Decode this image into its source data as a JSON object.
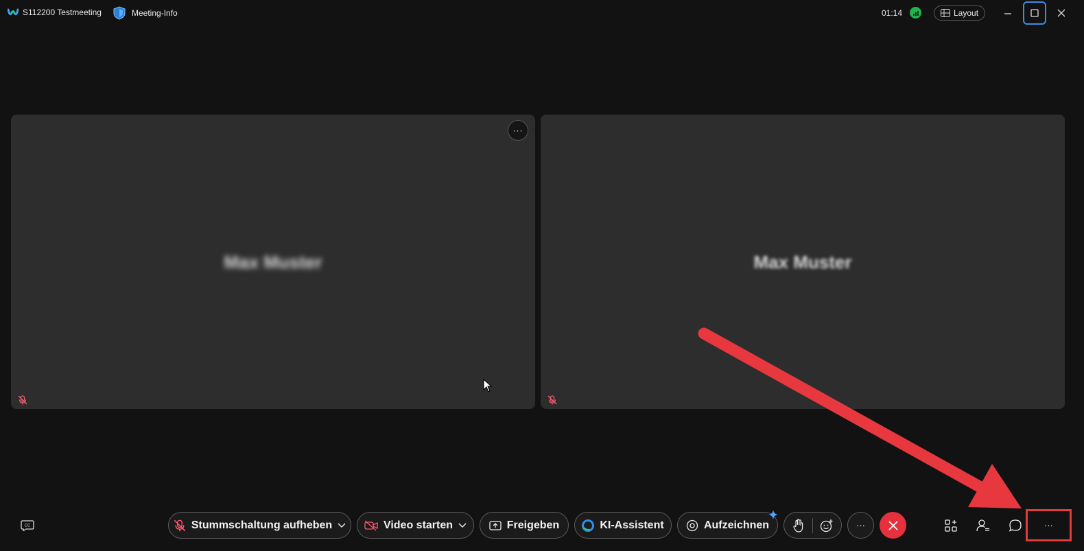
{
  "window": {
    "meeting_title": "S112200 Testmeeting",
    "meeting_info_label": "Meeting-Info",
    "elapsed_time": "01:14",
    "layout_label": "Layout"
  },
  "participants": [
    {
      "name": "Max Muster"
    },
    {
      "name": "Max Muster"
    }
  ],
  "toolbar": {
    "unmute_label": "Stummschaltung aufheben",
    "video_label": "Video starten",
    "share_label": "Freigeben",
    "ai_label": "KI-Assistent",
    "record_label": "Aufzeichnen",
    "more_glyph": "···",
    "menu_more_glyph": "···"
  },
  "colors": {
    "background": "#121212",
    "tile": "#2d2d2d",
    "end_call": "#e5303e",
    "muted_icon": "#ff5a6e",
    "connection": "#22b14c",
    "annotation_red": "#e23b3b",
    "focus_blue": "#3a8ee6"
  },
  "icons": [
    "webex-logo-icon",
    "shield-icon",
    "signal-icon",
    "layout-grid-icon",
    "minimize-icon",
    "maximize-icon",
    "close-icon",
    "captions-icon",
    "mic-off-icon",
    "chevron-down-icon",
    "video-off-icon",
    "share-screen-icon",
    "ai-assistant-icon",
    "record-icon",
    "sparkle-icon",
    "raise-hand-icon",
    "reaction-icon",
    "more-icon",
    "end-call-icon",
    "apps-icon",
    "participants-icon",
    "chat-icon"
  ]
}
